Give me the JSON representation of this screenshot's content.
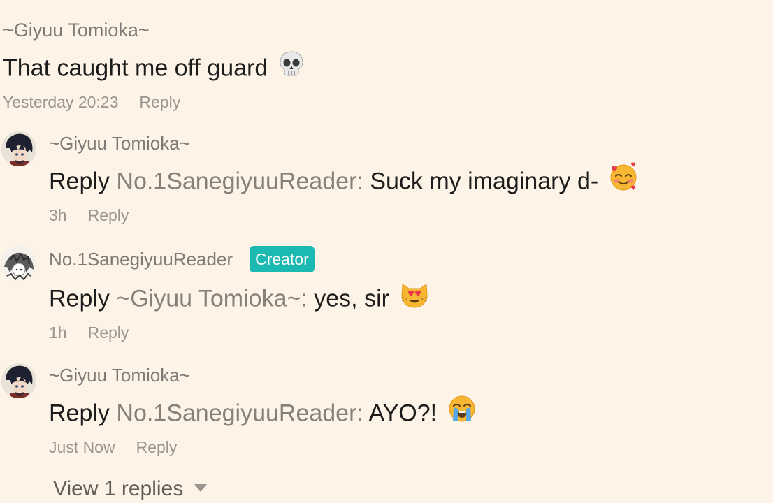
{
  "top_comment": {
    "author": "~Giyuu Tomioka~",
    "text": "That caught me off guard",
    "emoji": "skull-emoji",
    "time": "Yesterday 20:23",
    "reply_label": "Reply"
  },
  "replies": [
    {
      "author": "~Giyuu Tomioka~",
      "badge": "",
      "prefix": "Reply",
      "target": "No.1SanegiyuuReader:",
      "text": "Suck my imaginary d-",
      "emoji": "smiling-face-with-hearts-emoji",
      "time": "3h",
      "reply_label": "Reply"
    },
    {
      "author": "No.1SanegiyuuReader",
      "badge": "Creator",
      "prefix": "Reply",
      "target": "~Giyuu Tomioka~:",
      "text": "yes, sir",
      "emoji": "heart-eyes-cat-emoji",
      "time": "1h",
      "reply_label": "Reply"
    },
    {
      "author": "~Giyuu Tomioka~",
      "badge": "",
      "prefix": "Reply",
      "target": "No.1SanegiyuuReader:",
      "text": "AYO?!",
      "emoji": "loudly-crying-face-emoji",
      "time": "Just Now",
      "reply_label": "Reply"
    }
  ],
  "view_replies_label": "View 1 replies",
  "colors": {
    "background": "#fdf3e6",
    "creator_badge": "#1cb9b3",
    "muted_text": "#9a958f"
  }
}
